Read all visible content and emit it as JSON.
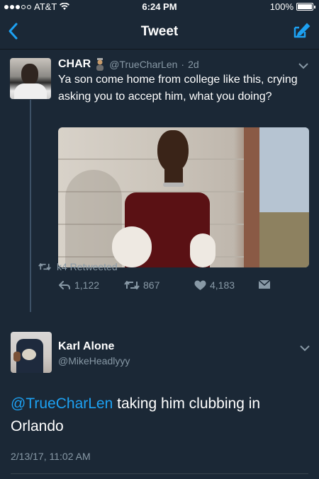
{
  "status_bar": {
    "carrier": "AT&T",
    "time": "6:24 PM",
    "battery": "100%",
    "battery_level": 1.0
  },
  "nav": {
    "title": "Tweet",
    "back_icon": "chevron-left-icon",
    "compose_icon": "compose-icon"
  },
  "original_tweet": {
    "name": "CHAR",
    "handle": "@TrueCharLen",
    "time_ago": "2d",
    "text": "Ya son come home from college like this, crying asking you to accept him, what you doing?",
    "replies": "1,122",
    "retweets": "867",
    "likes": "4,183"
  },
  "retweet_notice": "k4 Retweeted",
  "reply_tweet": {
    "name": "Karl Alone",
    "handle": "@MikeHeadlyyy",
    "mention": "@TrueCharLen",
    "text": " taking him clubbing in Orlando",
    "timestamp": "2/13/17, 11:02 AM"
  },
  "colors": {
    "background": "#1b2836",
    "secondary_text": "#8899a6",
    "accent": "#1da1f2"
  }
}
